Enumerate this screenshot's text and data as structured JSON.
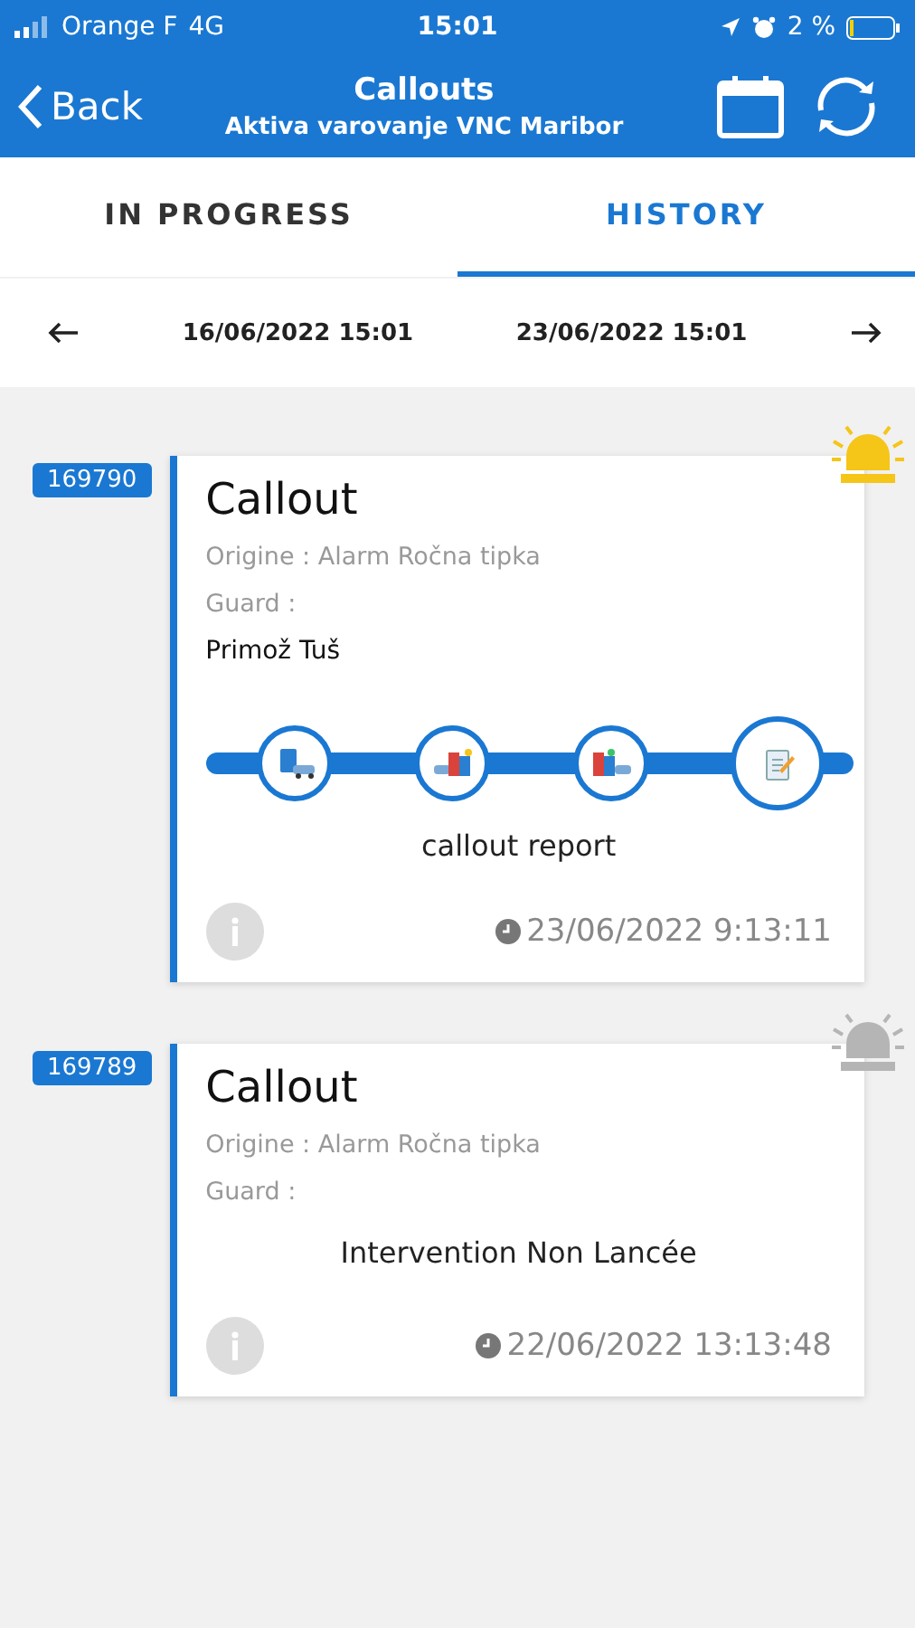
{
  "status_bar": {
    "carrier": "Orange F",
    "network": "4G",
    "time": "15:01",
    "battery": "2 %"
  },
  "header": {
    "back": "Back",
    "title": "Callouts",
    "subtitle": "Aktiva varovanje VNC Maribor"
  },
  "tabs": [
    {
      "label": "IN PROGRESS",
      "selected": false
    },
    {
      "label": "HISTORY",
      "selected": true
    }
  ],
  "date_range": {
    "from": "16/06/2022 15:01",
    "to": "23/06/2022 15:01"
  },
  "callouts": [
    {
      "id": "169790",
      "title": "Callout",
      "origin": "Origine : Alarm Ročna tipka",
      "guard_label": "Guard :",
      "guard": "Primož Tuš",
      "alarm_active": true,
      "kind": "progress",
      "steps": [
        {
          "selected": false
        },
        {
          "selected": false
        },
        {
          "selected": false
        },
        {
          "selected": true
        }
      ],
      "step_label": "callout report",
      "time": "23/06/2022 9:13:11"
    },
    {
      "id": "169789",
      "title": "Callout",
      "origin": "Origine : Alarm Ročna tipka",
      "guard_label": "Guard :",
      "alarm_active": false,
      "kind": "status",
      "status": "Intervention Non Lancée",
      "time": "22/06/2022 13:13:48"
    }
  ]
}
